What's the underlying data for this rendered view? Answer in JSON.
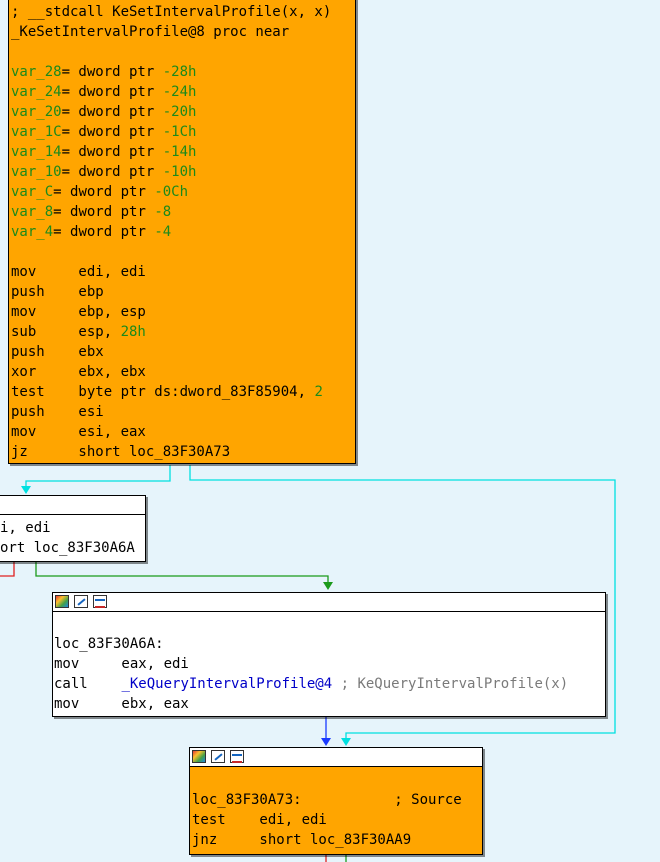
{
  "colors": {
    "background": "#e6f4fb",
    "block_highlight": "#ffa500",
    "block_normal": "#ffffff",
    "edge_fallthrough": "#00e0e0",
    "edge_taken_true": "#1b9a1b",
    "edge_taken_false": "#e02020",
    "edge_jump": "#1a3aff"
  },
  "icons": [
    "palette-icon",
    "edit-icon",
    "graph-icon"
  ],
  "block_main": {
    "lines": [
      [
        {
          "t": "; __stdcall KeSetIntervalProfile(x, x)",
          "c": "black"
        }
      ],
      [
        {
          "t": "_KeSetIntervalProfile@8 proc near",
          "c": "black"
        }
      ],
      [],
      [
        {
          "t": "var_28",
          "c": "green"
        },
        {
          "t": "= dword ptr ",
          "c": "black"
        },
        {
          "t": "-28h",
          "c": "green"
        }
      ],
      [
        {
          "t": "var_24",
          "c": "green"
        },
        {
          "t": "= dword ptr ",
          "c": "black"
        },
        {
          "t": "-24h",
          "c": "green"
        }
      ],
      [
        {
          "t": "var_20",
          "c": "green"
        },
        {
          "t": "= dword ptr ",
          "c": "black"
        },
        {
          "t": "-20h",
          "c": "green"
        }
      ],
      [
        {
          "t": "var_1C",
          "c": "green"
        },
        {
          "t": "= dword ptr ",
          "c": "black"
        },
        {
          "t": "-1Ch",
          "c": "green"
        }
      ],
      [
        {
          "t": "var_14",
          "c": "green"
        },
        {
          "t": "= dword ptr ",
          "c": "black"
        },
        {
          "t": "-14h",
          "c": "green"
        }
      ],
      [
        {
          "t": "var_10",
          "c": "green"
        },
        {
          "t": "= dword ptr ",
          "c": "black"
        },
        {
          "t": "-10h",
          "c": "green"
        }
      ],
      [
        {
          "t": "var_C",
          "c": "green"
        },
        {
          "t": "= dword ptr ",
          "c": "black"
        },
        {
          "t": "-0Ch",
          "c": "green"
        }
      ],
      [
        {
          "t": "var_8",
          "c": "green"
        },
        {
          "t": "= dword ptr ",
          "c": "black"
        },
        {
          "t": "-8",
          "c": "green"
        }
      ],
      [
        {
          "t": "var_4",
          "c": "green"
        },
        {
          "t": "= dword ptr ",
          "c": "black"
        },
        {
          "t": "-4",
          "c": "green"
        }
      ],
      [],
      [
        {
          "t": "mov     edi, edi",
          "c": "black"
        }
      ],
      [
        {
          "t": "push    ebp",
          "c": "black"
        }
      ],
      [
        {
          "t": "mov     ebp, esp",
          "c": "black"
        }
      ],
      [
        {
          "t": "sub     esp, ",
          "c": "black"
        },
        {
          "t": "28h",
          "c": "green"
        }
      ],
      [
        {
          "t": "push    ebx",
          "c": "black"
        }
      ],
      [
        {
          "t": "xor     ebx, ebx",
          "c": "black"
        }
      ],
      [
        {
          "t": "test    byte ptr ds:dword_83F85904, ",
          "c": "black"
        },
        {
          "t": "2",
          "c": "green"
        }
      ],
      [
        {
          "t": "push    esi",
          "c": "black"
        }
      ],
      [
        {
          "t": "mov     esi, eax",
          "c": "black"
        }
      ],
      [
        {
          "t": "jz      short loc_83F30A73",
          "c": "black"
        }
      ]
    ]
  },
  "block_left": {
    "lines": [
      [
        {
          "t": "i, edi",
          "c": "black"
        }
      ],
      [
        {
          "t": "ort loc_83F30A6A",
          "c": "black"
        }
      ]
    ]
  },
  "block_mid": {
    "lines": [
      [],
      [
        {
          "t": "loc_83F30A6A:",
          "c": "black"
        }
      ],
      [
        {
          "t": "mov     eax, edi",
          "c": "black"
        }
      ],
      [
        {
          "t": "call    ",
          "c": "black"
        },
        {
          "t": "_KeQueryIntervalProfile@4",
          "c": "blue"
        },
        {
          "t": " ; KeQueryIntervalProfile(x)",
          "c": "gray"
        }
      ],
      [
        {
          "t": "mov     ebx, eax",
          "c": "black"
        }
      ]
    ]
  },
  "block_bottom": {
    "lines": [
      [],
      [
        {
          "t": "loc_83F30A73:           ; Source",
          "c": "black"
        }
      ],
      [
        {
          "t": "test    edi, edi",
          "c": "black"
        }
      ],
      [
        {
          "t": "jnz     short loc_83F30AA9",
          "c": "black"
        }
      ]
    ]
  }
}
